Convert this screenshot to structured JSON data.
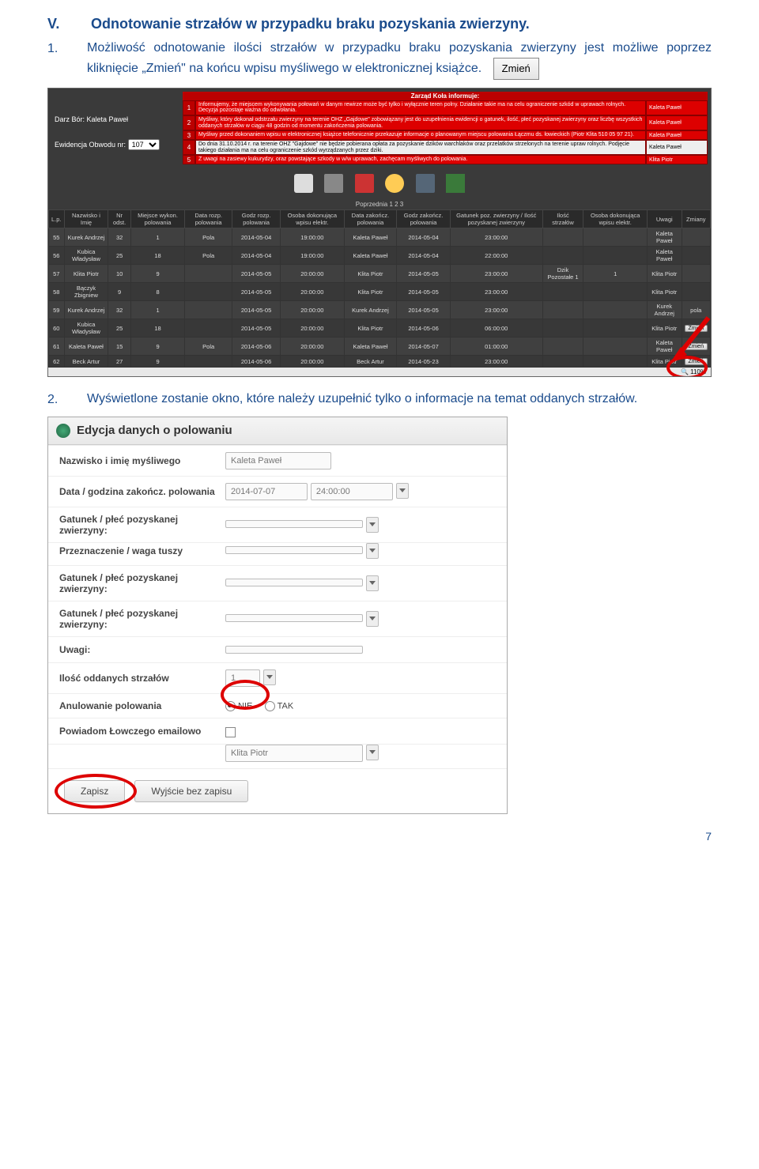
{
  "heading_num": "V.",
  "heading_text": "Odnotowanie strzałów w przypadku braku pozyskania zwierzyny.",
  "para1_num": "1.",
  "para1": "Możliwość odnotowanie ilości strzałów w przypadku braku pozyskania zwierzyny jest możliwe poprzez kliknięcie „Zmień\" na końcu wpisu myśliwego w elektronicznej książce.",
  "zmien_btn": "Zmień",
  "s1": {
    "left_line1": "Darz Bór: Kaleta Paweł",
    "left_line2": "Ewidencja Obwodu nr:",
    "left_sel": "107",
    "notice_hdr": "Zarząd Koła informuje:",
    "n1": "Informujemy, że miejscem wykonywania połowań w danym rewirze może być tylko i wyłącznie teren polny. Działanie takie ma na celu ograniczenie szkód w uprawach rolnych. Decyzja pozostaje ważna do odwołania.",
    "n2": "Myśliwy, który dokonał odstrzału zwierzyny na terenie OHZ „Gajdowe\" zobowiązany jest do uzupełnienia ewidencji o gatunek, ilość, płeć pozyskanej zwierzyny oraz liczbę wszystkich oddanych strzałów w ciągu 48 godzin od momentu zakończenia polowania.",
    "n3": "Myśliwy przed dokonaniem wpisu w elektronicznej książce telefonicznie przekazuje informacje o planowanym miejscu polowania Łączmu ds. łowieckich (Piotr Klita 510 05 97 21).",
    "n4": "Do dnia 31.10.2014 r. na terenie OHZ \"Gajdowe\" nie będzie pobierana opłata za pozyskanie dzików warchlaków oraz przelatków strzelonych na terenie upraw rolnych. Podjęcie takiego działania ma na celu ograniczenie szkód wyrządzanych przez dziki.",
    "n5": "Z uwagi na zasiewy kukurydzy, oraz powstające szkody w w/w uprawach, zachęcam myśliwych do polowania.",
    "auth1": "Kaleta Paweł",
    "auth2": "Kaleta Paweł",
    "auth3": "Kaleta Paweł",
    "auth4": "Kaleta Paweł",
    "auth5": "Klita Piotr",
    "pager": "Poprzednia 1 2 3",
    "cols": [
      "L.p.",
      "Nazwisko i Imię",
      "Nr odst.",
      "Miejsce wykon. polowania",
      "Data rozp. polowania",
      "Godz rozp. polowania",
      "Osoba dokonująca wpisu elektr.",
      "Data zakończ. polowania",
      "Godz zakończ. polowania",
      "Gatunek poz. zwierzyny / Ilość pozyskanej zwierzyny",
      "Ilość strzałów",
      "Osoba dokonująca wpisu elektr.",
      "Uwagi",
      "Zmiany"
    ],
    "rows": [
      [
        "55",
        "Kurek Andrzej",
        "32",
        "1",
        "Pola",
        "2014-05-04",
        "19:00:00",
        "Kaleta Paweł",
        "2014-05-04",
        "23:00:00",
        "",
        "",
        "Kaleta Paweł",
        "",
        ""
      ],
      [
        "56",
        "Kubica Władysław",
        "25",
        "18",
        "Pola",
        "2014-05-04",
        "19:00:00",
        "Kaleta Paweł",
        "2014-05-04",
        "22:00:00",
        "",
        "",
        "Kaleta Paweł",
        "",
        ""
      ],
      [
        "57",
        "Klita Piotr",
        "10",
        "9",
        "",
        "2014-05-05",
        "20:00:00",
        "Klita Piotr",
        "2014-05-05",
        "23:00:00",
        "Dzik Pozostałe       1",
        "1",
        "Klita Piotr",
        "",
        ""
      ],
      [
        "58",
        "Bączyk Zbigniew",
        "9",
        "8",
        "",
        "2014-05-05",
        "20:00:00",
        "Klita Piotr",
        "2014-05-05",
        "23:00:00",
        "",
        "",
        "Klita Piotr",
        "",
        ""
      ],
      [
        "59",
        "Kurek Andrzej",
        "32",
        "1",
        "",
        "2014-05-05",
        "20:00:00",
        "Kurek Andrzej",
        "2014-05-05",
        "23:00:00",
        "",
        "",
        "Kurek Andrzej",
        "pola",
        ""
      ],
      [
        "60",
        "Kubica Władysław",
        "25",
        "18",
        "",
        "2014-05-05",
        "20:00:00",
        "Klita Piotr",
        "2014-05-06",
        "06:00:00",
        "",
        "",
        "Klita Piotr",
        "",
        "Zmień"
      ],
      [
        "61",
        "Kaleta Paweł",
        "15",
        "9",
        "Pola",
        "2014-05-06",
        "20:00:00",
        "Kaleta Paweł",
        "2014-05-07",
        "01:00:00",
        "",
        "",
        "Kaleta Paweł",
        "",
        "Zmień"
      ],
      [
        "62",
        "Beck Artur",
        "27",
        "9",
        "",
        "2014-05-06",
        "20:00:00",
        "Beck Artur",
        "2014-05-23",
        "23:00:00",
        "",
        "",
        "Klita Piotr",
        "",
        "Zmień"
      ]
    ],
    "zoom": "🔍 110%"
  },
  "para2_num": "2.",
  "para2": "Wyświetlone zostanie okno, które należy uzupełnić tylko o informacje na temat oddanych strzałów.",
  "s2": {
    "title": "Edycja danych o polowaniu",
    "l_name": "Nazwisko i imię myśliwego",
    "v_name": "Kaleta Paweł",
    "l_date": "Data / godzina zakończ. polowania",
    "v_date": "2014-07-07",
    "v_time": "24:00:00",
    "l_g1": "Gatunek / płeć pozyskanej zwierzyny:",
    "l_dest": "Przeznaczenie / waga tuszy",
    "l_g2": "Gatunek / płeć pozyskanej zwierzyny:",
    "l_g3": "Gatunek / płeć pozyskanej zwierzyny:",
    "l_rem": "Uwagi:",
    "l_shots": "Ilość oddanych strzałów",
    "v_shots": "1",
    "l_cancel": "Anulowanie polowania",
    "r_nie": "NIE",
    "r_tak": "TAK",
    "l_mail": "Powiadom Łowczego emailowo",
    "v_sel": "Klita Piotr",
    "b_save": "Zapisz",
    "b_exit": "Wyjście bez zapisu"
  },
  "pagenum": "7"
}
